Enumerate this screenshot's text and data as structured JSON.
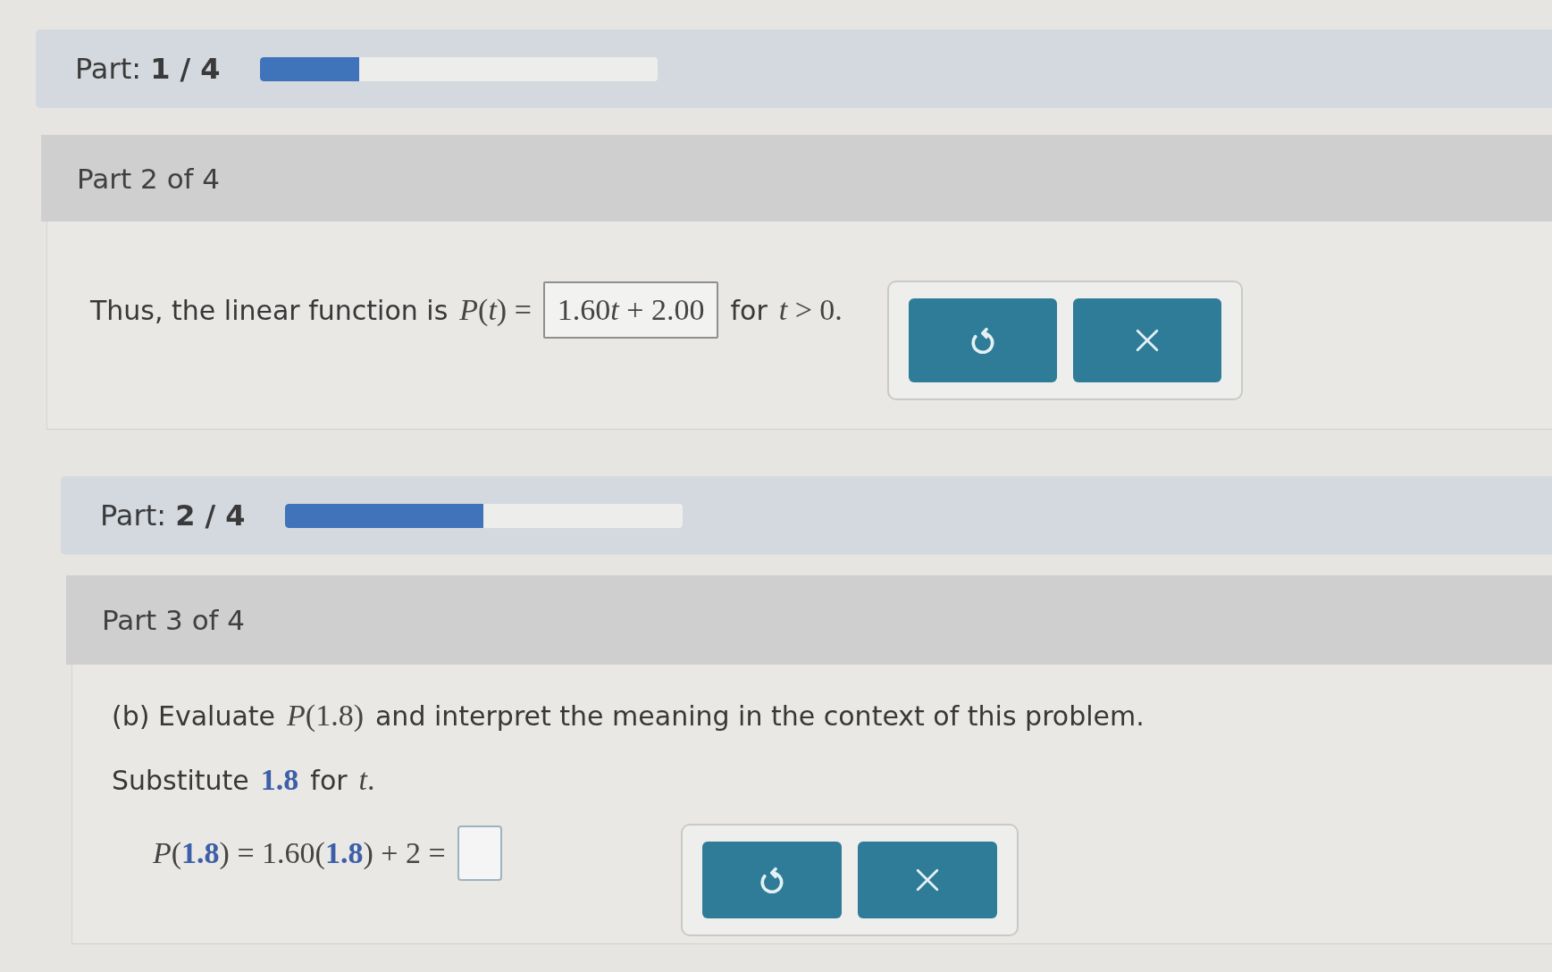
{
  "sections": [
    {
      "progress": {
        "label": "Part: **1 / 4**",
        "level": 0.25
      },
      "header": "Part 2 of 4",
      "lines": [
        {
          "kind": "text",
          "segments": [
            {
              "kind": "text",
              "text": "Thus, the linear function is"
            },
            {
              "kind": "math",
              "text": "P(t) ="
            },
            {
              "kind": "answer",
              "value": "1.60t + 2.00"
            },
            {
              "kind": "text",
              "text": "for"
            },
            {
              "kind": "math",
              "text": "t > 0."
            }
          ],
          "actions": [
            {
              "kind": "undo"
            },
            {
              "kind": "clear"
            }
          ]
        }
      ]
    },
    {
      "progress": {
        "label": "Part: **2 / 4**",
        "level": 0.5
      },
      "header": "Part 3 of 4",
      "lines": [
        {
          "kind": "text",
          "segments": [
            {
              "kind": "text",
              "text": "(b) Evaluate"
            },
            {
              "kind": "math",
              "text": "P(1.8)"
            },
            {
              "kind": "text",
              "text": "and interpret the meaning in the context of this problem."
            }
          ]
        },
        {
          "kind": "text",
          "segments": [
            {
              "kind": "text",
              "text": "Substitute"
            },
            {
              "kind": "math",
              "text": "**1.8**"
            },
            {
              "kind": "text",
              "text": "for"
            },
            {
              "kind": "math",
              "text": "t."
            }
          ]
        },
        {
          "kind": "equation",
          "segments": [
            {
              "kind": "math",
              "text": "P(**1.8**) = 1.60(**1.8**) + 2 ="
            },
            {
              "kind": "answer"
            }
          ],
          "actions": [
            {
              "kind": "undo"
            },
            {
              "kind": "clear"
            }
          ]
        }
      ]
    }
  ]
}
